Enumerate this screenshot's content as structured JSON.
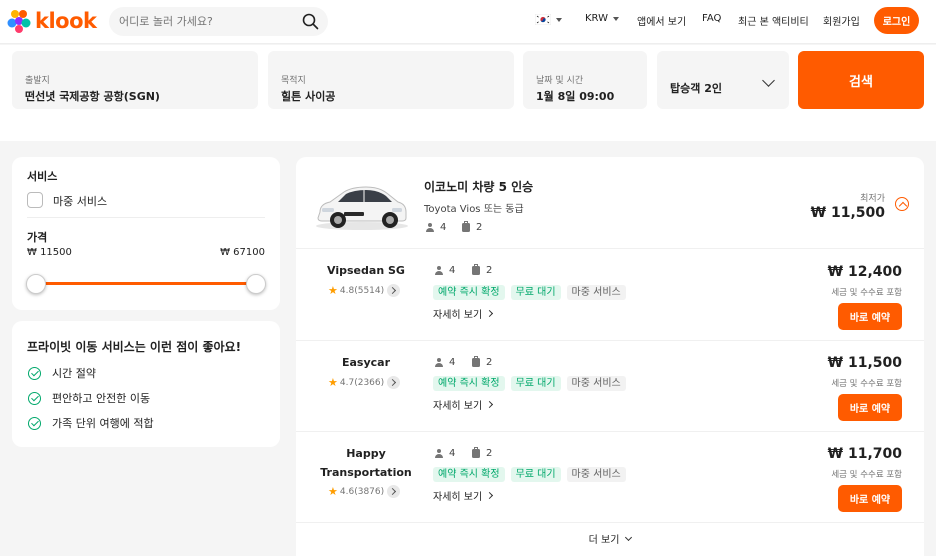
{
  "header": {
    "logo_text": "klook",
    "search_placeholder": "어디로 놀러 가세요?",
    "nav": {
      "currency": "KRW",
      "app": "앱에서 보기",
      "faq": "FAQ",
      "recent": "최근 본 액티비티",
      "signup": "회원가입",
      "login": "로그인"
    }
  },
  "search_form": {
    "from_label": "출발지",
    "from_value": "떤선녓 국제공항 공항(SGN)",
    "to_label": "목적지",
    "to_value": "힐튼 사이공",
    "date_label": "날짜 및 시간",
    "date_value": "1월 8일 09:00",
    "passengers_value": "탑승객 2인",
    "search_button": "검색"
  },
  "filters": {
    "service_title": "서비스",
    "meet_service": "마중 서비스",
    "price_title": "가격",
    "price_min": "₩ 11500",
    "price_max": "₩ 67100",
    "slider_min_value": 11500,
    "slider_max_value": 67100,
    "accent_color": "#ff5b00"
  },
  "benefits": {
    "title": "프라이빗 이동 서비스는 이런 점이 좋아요!",
    "items": [
      "시간 절약",
      "편안하고 안전한 이동",
      "가족 단위 여행에 적합"
    ]
  },
  "car": {
    "title": "이코노미 차량 5 인승",
    "subtitle": "Toyota Vios 또는 동급",
    "passengers": "4",
    "luggage": "2",
    "min_label": "최저가",
    "min_price": "₩ 11,500"
  },
  "vendors": [
    {
      "name": "Vipsedan SG",
      "rating": "4.8",
      "reviews": "(5514)",
      "passengers": "4",
      "luggage": "2",
      "tag1": "예약 즉시 확정",
      "tag2": "무료 대기",
      "tag3": "마중 서비스",
      "details": "자세히 보기",
      "price": "₩ 12,400",
      "fee": "세금 및 수수료 포함",
      "book": "바로 예약"
    },
    {
      "name": "Easycar",
      "rating": "4.7",
      "reviews": "(2366)",
      "passengers": "4",
      "luggage": "2",
      "tag1": "예약 즉시 확정",
      "tag2": "무료 대기",
      "tag3": "마중 서비스",
      "details": "자세히 보기",
      "price": "₩ 11,500",
      "fee": "세금 및 수수료 포함",
      "book": "바로 예약"
    },
    {
      "name": "Happy Transportation",
      "rating": "4.6",
      "reviews": "(3876)",
      "passengers": "4",
      "luggage": "2",
      "tag1": "예약 즉시 확정",
      "tag2": "무료 대기",
      "tag3": "마중 서비스",
      "details": "자세히 보기",
      "price": "₩ 11,700",
      "fee": "세금 및 수수료 포함",
      "book": "바로 예약"
    }
  ],
  "more_label": "더 보기"
}
